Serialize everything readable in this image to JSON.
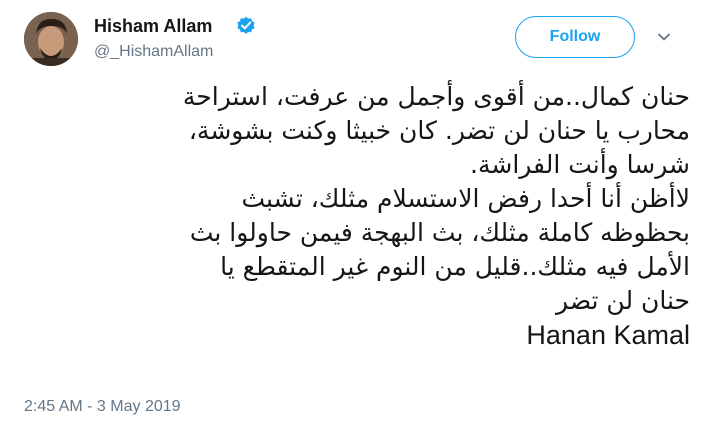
{
  "author": {
    "display_name": "Hisham Allam",
    "handle": "@_HishamAllam",
    "verified": true,
    "avatar_icon": "profile-photo"
  },
  "actions": {
    "follow_label": "Follow",
    "more_icon": "chevron-down-icon"
  },
  "tweet": {
    "lines": [
      "حنان كمال..من أقوى وأجمل من عرفت، استراحة",
      "محارب يا حنان لن تضر. كان خبيثا وكنت بشوشة،",
      "شرسا وأنت الفراشة.",
      "لاأظن أنا أحدا رفض الاستسلام مثلك، تشبث",
      "بحظوظه كاملة مثلك، بث البهجة فيمن حاولوا بث",
      "الأمل فيه مثلك..قليل من النوم غير المتقطع يا",
      "حنان لن تضر"
    ],
    "signature": "Hanan Kamal"
  },
  "timestamp": "2:45 AM - 3 May 2019",
  "colors": {
    "accent": "#1da1f2",
    "text": "#14171a",
    "secondary": "#657786"
  }
}
